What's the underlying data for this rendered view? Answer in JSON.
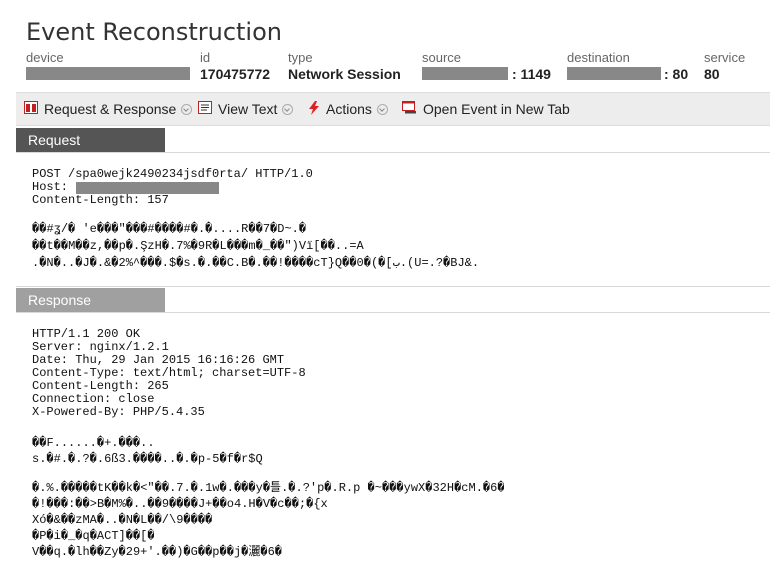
{
  "page": {
    "title": "Event Reconstruction"
  },
  "meta": {
    "device_label": "device",
    "id_label": "id",
    "id_value": "170475772",
    "type_label": "type",
    "type_value": "Network Session",
    "source_label": "source",
    "source_port": ": 1149",
    "destination_label": "destination",
    "destination_port": ": 80",
    "service_label": "service",
    "service_value": "80"
  },
  "toolbar": {
    "request_response": "Request & Response",
    "view_text": "View Text",
    "actions": "Actions",
    "open_event": "Open Event in New Tab"
  },
  "request": {
    "tab_label": "Request",
    "line1": "POST /spa0wejk2490234jsdf0rta/ HTTP/1.0",
    "host_label": "Host:",
    "line3": "Content-Length: 157",
    "body1": "��#ʓ/� 'e���\"���#����#�.�....R��7�D~.�",
    "body2": "��t��M��z,��p�.ŞzH�.7%�9R�L���m�_��\")Vï[��..=A",
    "body3": ".�N�..�J�.&�2%^���.$�s.�.��C.B�.��!����cT}Q��0�(�[ب.(U=.?�BJ&."
  },
  "response": {
    "tab_label": "Response",
    "headers": "HTTP/1.1 200 OK\nServer: nginx/1.2.1\nDate: Thu, 29 Jan 2015 16:16:26 GMT\nContent-Type: text/html; charset=UTF-8\nContent-Length: 265\nConnection: close\nX-Powered-By: PHP/5.4.35",
    "body_a": "��F......�+.���..\ns.�#.�.?�.6ß3.����..�.�p-5�f�r$Q",
    "body_b": "�.%.�����tK��k�<\"��.7.�.1w�.���y�틀.�.?'p�.R.p �~���ywX�32H�cM.�6�\n�!���:��>B�M%�..��9����J+��o4.H�V�c��;�{x\nXó�&��zMA�..�N�L��/\\9����\n�P�i�_�q�ACT]��[�\nV��q.�lh��Zy�29+'.��)�G��p��j�灑�6�"
  },
  "colors": {
    "request_tab": "#555555",
    "response_tab": "#a0a0a0",
    "toolbar_bg": "#ededed",
    "actions_icon": "#e02020"
  }
}
